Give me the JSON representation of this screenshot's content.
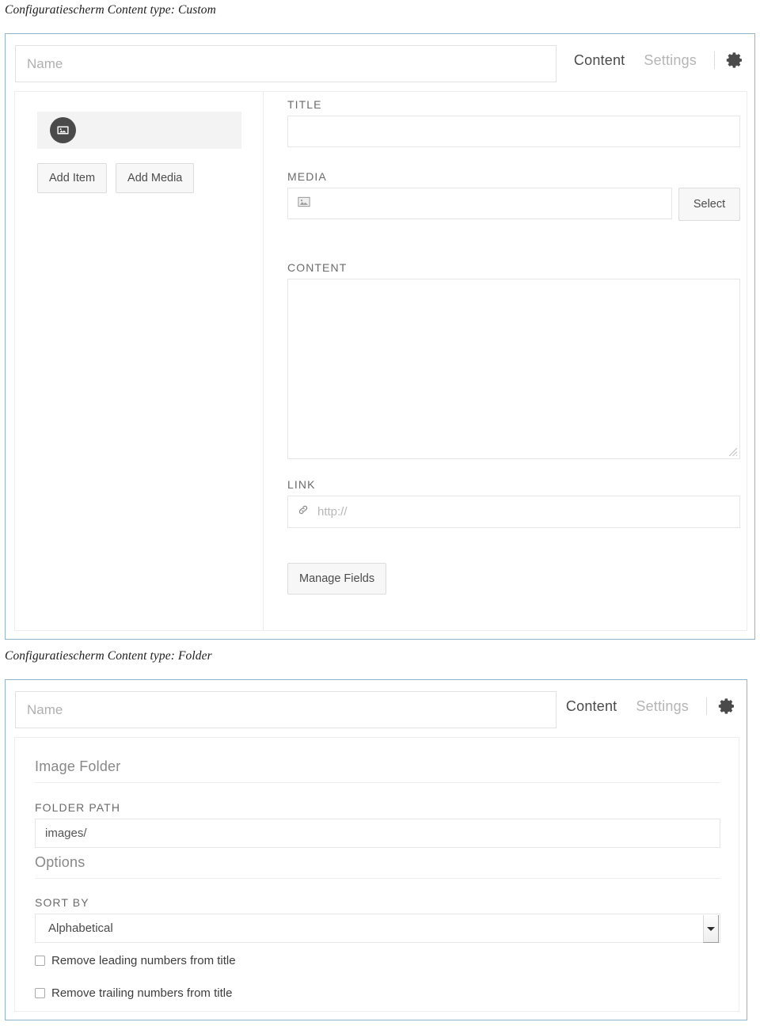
{
  "captions": {
    "custom": "Configuratiescherm Content type: Custom",
    "folder": "Configuratiescherm Content type: Folder"
  },
  "panel_custom": {
    "header": {
      "name_placeholder": "Name",
      "name_value": "",
      "tab_content": "Content",
      "tab_settings": "Settings",
      "gear_icon": "gear-icon"
    },
    "left_column": {
      "thumbnail_icon": "image-icon",
      "add_item_label": "Add Item",
      "add_media_label": "Add Media"
    },
    "right_column": {
      "title_label": "TITLE",
      "title_value": "",
      "title_placeholder": "",
      "media_label": "MEDIA",
      "media_icon": "image-placeholder-icon",
      "media_value": "",
      "select_label": "Select",
      "content_label": "CONTENT",
      "content_value": "",
      "link_label": "LINK",
      "link_icon": "link-chain-icon",
      "link_placeholder": "http://",
      "link_value": "",
      "manage_fields_label": "Manage Fields"
    }
  },
  "panel_folder": {
    "header": {
      "name_placeholder": "Name",
      "name_value": "",
      "tab_content": "Content",
      "tab_settings": "Settings",
      "gear_icon": "gear-icon"
    },
    "image_folder_section": {
      "title": "Image Folder",
      "folder_path_label": "FOLDER PATH",
      "folder_path_value": "images/"
    },
    "options_section": {
      "title": "Options",
      "sort_by_label": "SORT BY",
      "sort_by_value": "Alphabetical",
      "checkbox_leading": "Remove leading numbers from title",
      "checkbox_trailing": "Remove trailing numbers from title"
    }
  },
  "colors": {
    "panel_border": "#8fb4cc",
    "inner_border": "#eeeeee",
    "tab_active": "#4a4a4a",
    "tab_inactive": "#b5b5b5",
    "thumb_circle": "#4a4a4a",
    "strip_bg": "#f3f3f3",
    "button_bg": "#f7f7f7"
  }
}
